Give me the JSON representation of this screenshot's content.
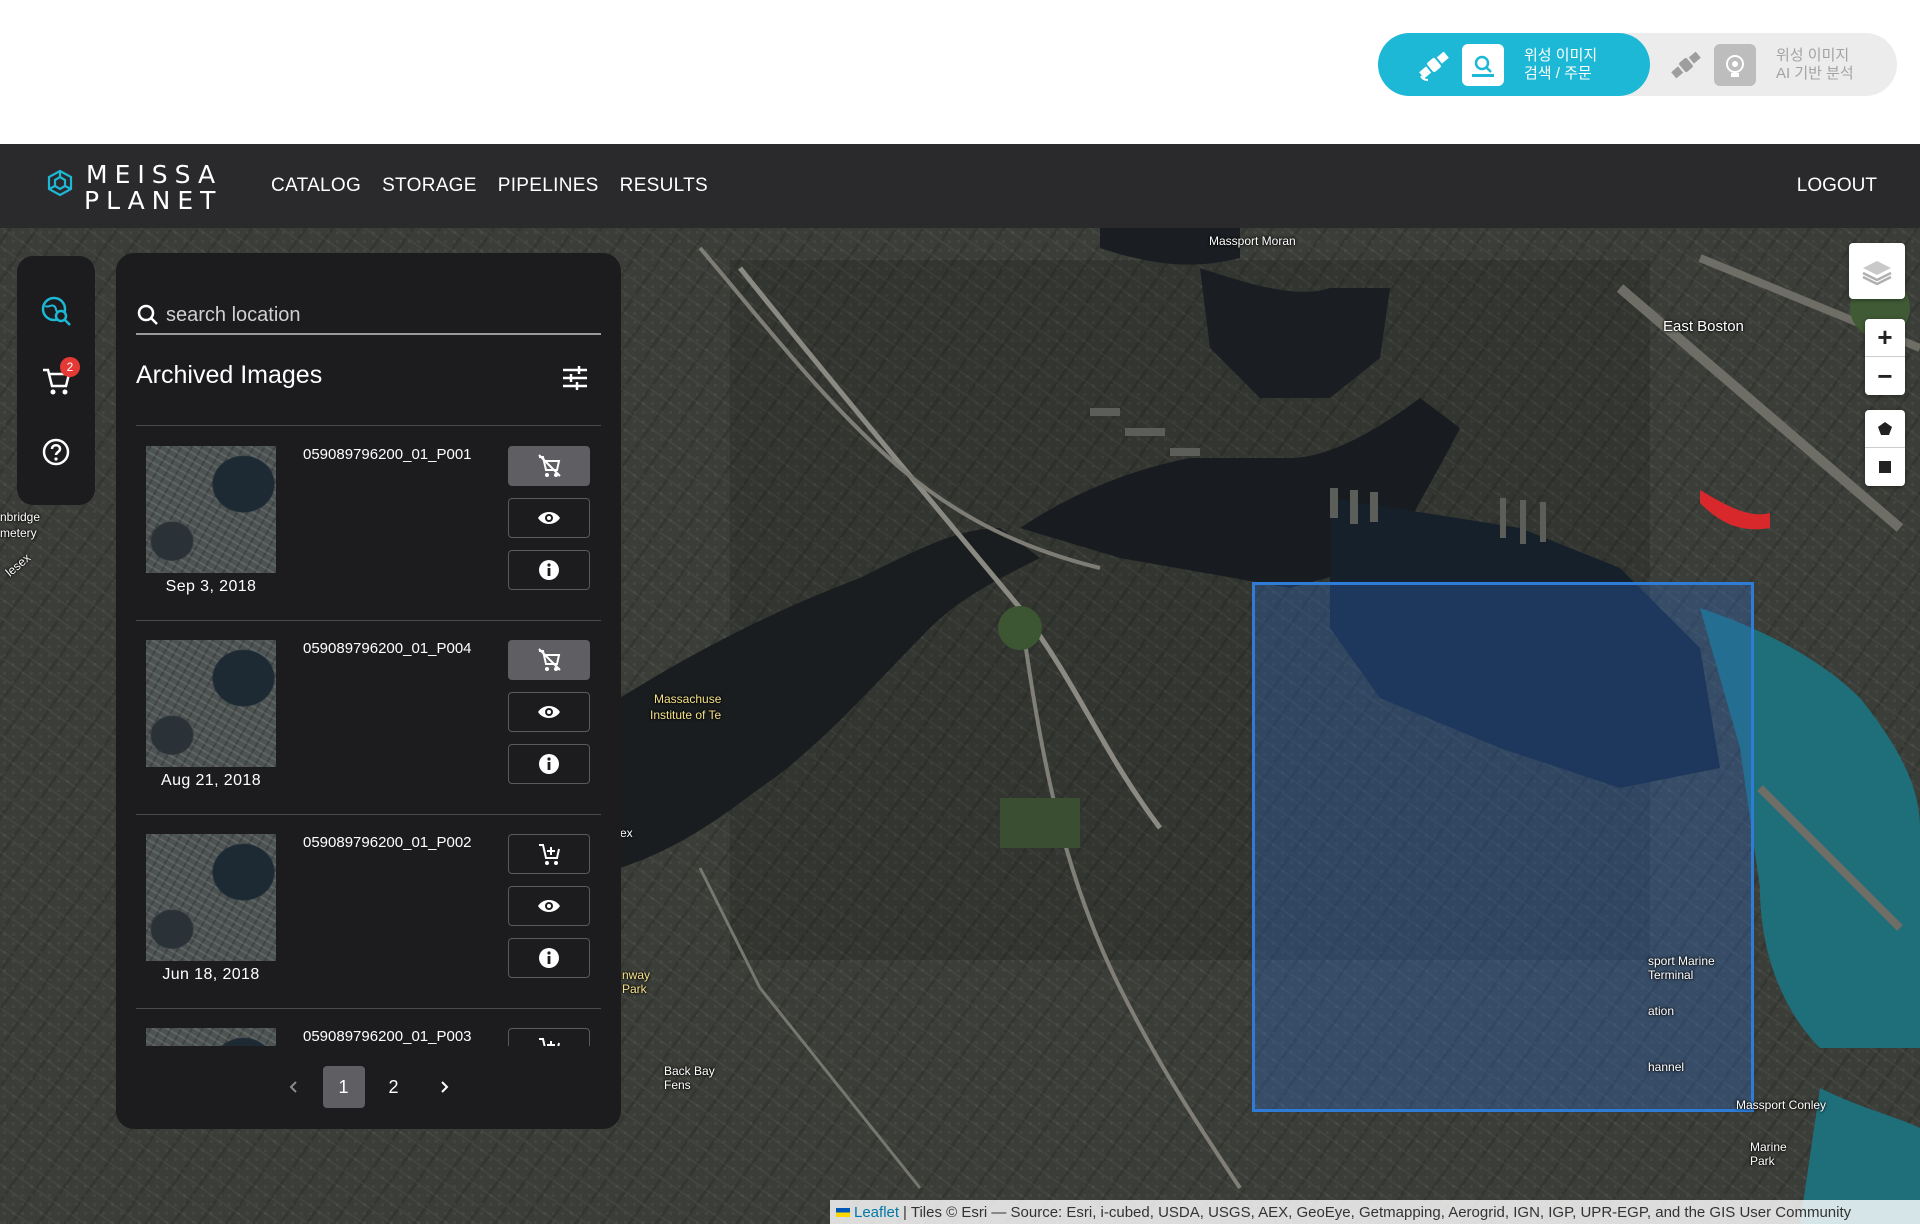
{
  "mode_toggle": {
    "active": {
      "line1": "위성 이미지",
      "line2": "검색 / 주문"
    },
    "inactive": {
      "line1": "위성 이미지",
      "line2": "AI 기반 분석"
    }
  },
  "navbar": {
    "logo_line1": "MEISSA",
    "logo_line2": "PLANET",
    "links": [
      "CATALOG",
      "STORAGE",
      "PIPELINES",
      "RESULTS"
    ],
    "logout": "LOGOUT"
  },
  "sidebar": {
    "cart_count": "2"
  },
  "panel": {
    "search_placeholder": "search location",
    "title": "Archived Images",
    "items": [
      {
        "id": "059089796200_01_P001",
        "date": "Sep 3, 2018",
        "in_cart": true
      },
      {
        "id": "059089796200_01_P004",
        "date": "Aug 21, 2018",
        "in_cart": true
      },
      {
        "id": "059089796200_01_P002",
        "date": "Jun 18, 2018",
        "in_cart": false
      },
      {
        "id": "059089796200_01_P003",
        "date": "",
        "in_cart": false
      }
    ],
    "pagination": {
      "pages": [
        "1",
        "2"
      ],
      "current": "1"
    }
  },
  "map": {
    "labels": {
      "east_boston": "East Boston",
      "massport_moran": "Massport Moran",
      "massachusetts": "Massachuse",
      "institute": "Institute of Te",
      "cambridge": "nbridge",
      "cemetery": "metery",
      "middlesex": "lesex",
      "back_bay_fens": "Back Bay Fens",
      "fenway_park": "nway Park",
      "marine_terminal": "sport Marine Terminal",
      "station": "ation",
      "channel": "hannel",
      "massport_conley": "Massport Conley",
      "marine_park": "Marine Park",
      "ex": "ex"
    },
    "selection_color": "#2f7cd6"
  },
  "attribution": {
    "leaflet": "Leaflet",
    "text": "| Tiles © Esri — Source: Esri, i-cubed, USDA, USGS, AEX, GeoEye, Getmapping, Aerogrid, IGN, IGP, UPR-EGP, and the GIS User Community"
  },
  "colors": {
    "accent": "#1db8d6",
    "navbar": "#2a2a2d",
    "panel": "#1c1c1e",
    "badge": "#e53935"
  }
}
